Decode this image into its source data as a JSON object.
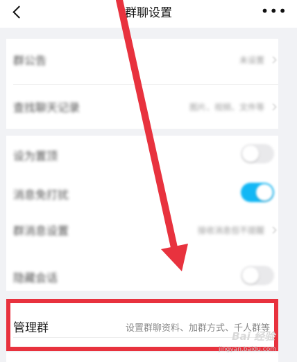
{
  "header": {
    "title": "群聊设置",
    "more": "•••"
  },
  "settings": {
    "notice": {
      "label": "群公告",
      "value": "未设置"
    },
    "search": {
      "label": "查找聊天记录",
      "value": "图片、视频、文件等"
    },
    "pin": {
      "label": "设为置顶",
      "on": false
    },
    "dnd": {
      "label": "消息免打扰",
      "on": true
    },
    "msg_setting": {
      "label": "群消息设置",
      "value": "接收消息但不提醒"
    },
    "hide": {
      "label": "隐藏会话",
      "on": false
    }
  },
  "manage": {
    "label": "管理群",
    "desc": "设置群聊资料、加群方式、千人群等"
  },
  "watermark": {
    "text": "Bai 经验",
    "sub": "jingyan.baidu.com"
  },
  "colors": {
    "highlight": "#e8323e",
    "toggle_on": "#12b7f5",
    "arrow": "#e8323e"
  },
  "icons": [
    "back-chevron-icon",
    "more-dots-icon",
    "chevron-right-icon",
    "red-arrow-annotation"
  ]
}
